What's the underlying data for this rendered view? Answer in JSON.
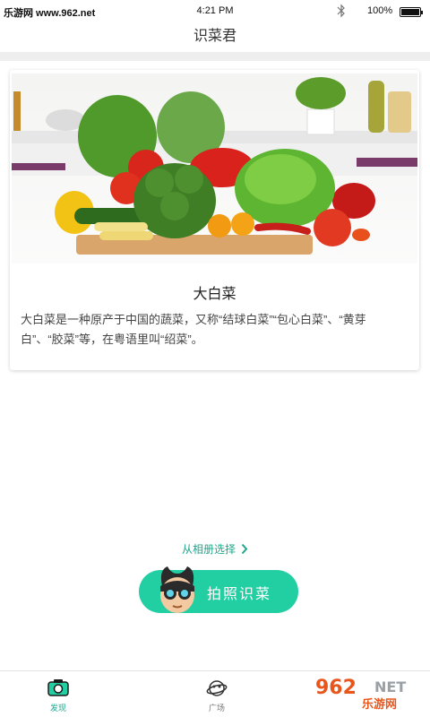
{
  "status_bar": {
    "watermark": "乐游网 www.962.net",
    "time": "4:21 PM",
    "battery": "100%"
  },
  "app": {
    "title": "识菜君"
  },
  "result": {
    "name": "大白菜",
    "description": "大白菜是一种原产于中国的蔬菜，又称“结球白菜”“包心白菜”、“黄芽白”、“胶菜”等，在粤语里叫“绍菜”。"
  },
  "actions": {
    "album_label": "从相册选择",
    "camera_label": "拍照识菜"
  },
  "bottom_nav": {
    "items": [
      {
        "label": "发现",
        "icon": "camera-icon"
      },
      {
        "label": "广场",
        "icon": "planet-icon"
      }
    ]
  },
  "watermark_logo": {
    "text_top": "962",
    "text_net": "NET",
    "text_bottom": "乐游网"
  },
  "colors": {
    "accent": "#22cfa3",
    "accent_text": "#1fa68d",
    "divider": "#eeeeee"
  }
}
